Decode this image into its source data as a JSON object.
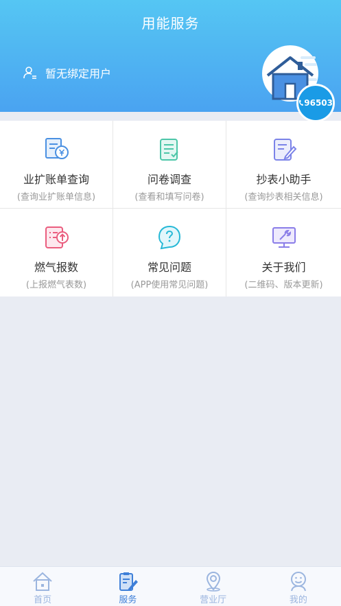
{
  "header": {
    "title": "用能服务",
    "user_text": "暂无绑定用户",
    "hotline": "96503"
  },
  "services": [
    {
      "title": "业扩账单查询",
      "subtitle": "(查询业扩账单信息)",
      "icon": "bill-icon",
      "color": "#4a90e2"
    },
    {
      "title": "问卷调查",
      "subtitle": "(查看和填写问卷)",
      "icon": "survey-icon",
      "color": "#4cc6a8"
    },
    {
      "title": "抄表小助手",
      "subtitle": "(查询抄表相关信息)",
      "icon": "meter-edit-icon",
      "color": "#7b83e8"
    },
    {
      "title": "燃气报数",
      "subtitle": "(上报燃气表数)",
      "icon": "upload-report-icon",
      "color": "#ea5d7e"
    },
    {
      "title": "常见问题",
      "subtitle": "(APP使用常见问题)",
      "icon": "question-icon",
      "color": "#25b8d6"
    },
    {
      "title": "关于我们",
      "subtitle": "(二维码、版本更新)",
      "icon": "monitor-tools-icon",
      "color": "#8a7de8"
    }
  ],
  "tabs": [
    {
      "label": "首页",
      "icon": "home-icon",
      "active": false
    },
    {
      "label": "服务",
      "icon": "service-icon",
      "active": true
    },
    {
      "label": "营业厅",
      "icon": "location-icon",
      "active": false
    },
    {
      "label": "我的",
      "icon": "profile-icon",
      "active": false
    }
  ]
}
